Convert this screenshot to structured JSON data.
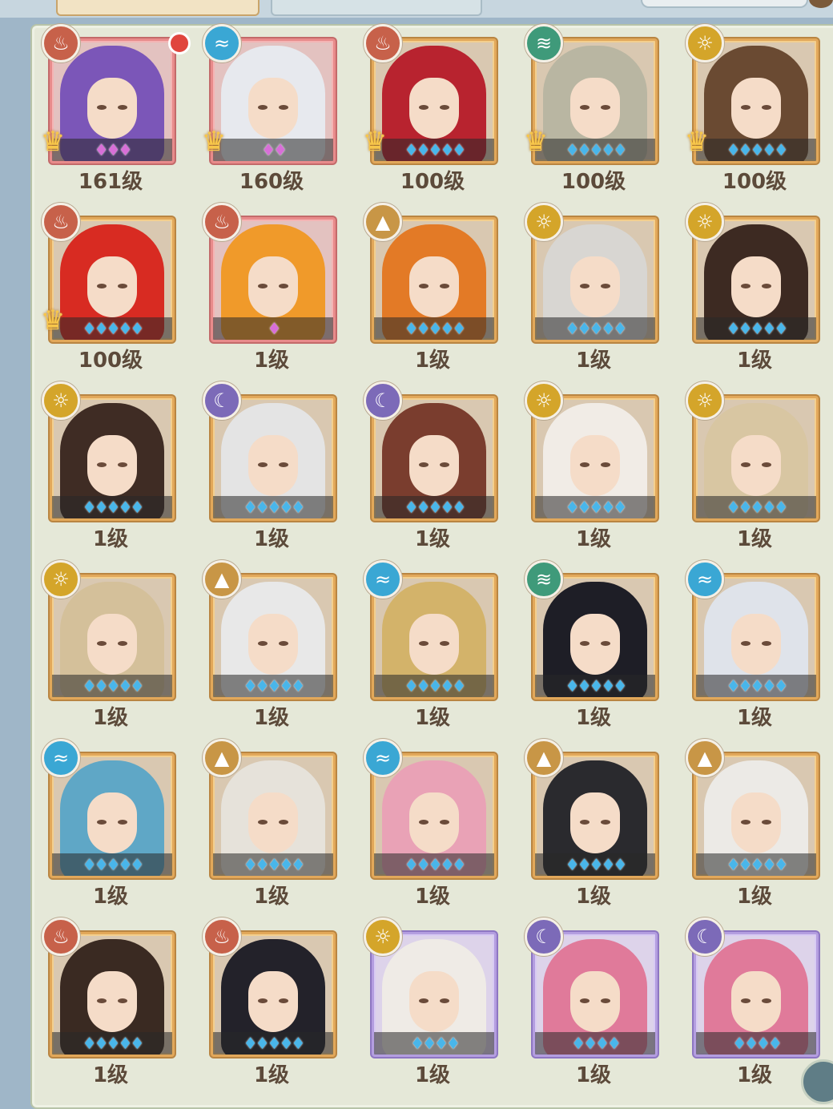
{
  "tabs": [
    {
      "label": "",
      "active": true
    },
    {
      "label": "",
      "active": false
    }
  ],
  "elements": {
    "fire": {
      "icon": "flame-icon",
      "glyph": "♨",
      "color": "#c7614a"
    },
    "water": {
      "icon": "wave-icon",
      "glyph": "≈",
      "color": "#3aa7d4"
    },
    "wind": {
      "icon": "tornado-icon",
      "glyph": "≋",
      "color": "#3f9a7a"
    },
    "light": {
      "icon": "sun-icon",
      "glyph": "☼",
      "color": "#d4a52a"
    },
    "earth": {
      "icon": "mountain-icon",
      "glyph": "▲",
      "color": "#c89646"
    },
    "void": {
      "icon": "crescent-icon",
      "glyph": "☾",
      "color": "#7c6ab8"
    }
  },
  "characters": [
    {
      "level": "161级",
      "element": "fire",
      "frame": "red",
      "stars": 3,
      "star_color": "pink",
      "awakened": true,
      "notification": true,
      "hair": "#7b56b8"
    },
    {
      "level": "160级",
      "element": "water",
      "frame": "red",
      "stars": 2,
      "star_color": "pink",
      "awakened": true,
      "notification": false,
      "hair": "#e7e9ee"
    },
    {
      "level": "100级",
      "element": "fire",
      "frame": "orange",
      "stars": 5,
      "star_color": "blue",
      "awakened": true,
      "notification": false,
      "hair": "#b8232f"
    },
    {
      "level": "100级",
      "element": "wind",
      "frame": "orange",
      "stars": 5,
      "star_color": "blue",
      "awakened": true,
      "notification": false,
      "hair": "#b9b6a2"
    },
    {
      "level": "100级",
      "element": "light",
      "frame": "orange",
      "stars": 5,
      "star_color": "blue",
      "awakened": true,
      "notification": false,
      "hair": "#6a4a32"
    },
    {
      "level": "100级",
      "element": "fire",
      "frame": "orange",
      "stars": 5,
      "star_color": "blue",
      "awakened": true,
      "notification": false,
      "hair": "#d82b22"
    },
    {
      "level": "1级",
      "element": "fire",
      "frame": "red",
      "stars": 1,
      "star_color": "pink",
      "awakened": false,
      "notification": false,
      "hair": "#f09a2a"
    },
    {
      "level": "1级",
      "element": "earth",
      "frame": "orange",
      "stars": 5,
      "star_color": "blue",
      "awakened": false,
      "notification": false,
      "hair": "#e37a26"
    },
    {
      "level": "1级",
      "element": "light",
      "frame": "orange",
      "stars": 5,
      "star_color": "blue",
      "awakened": false,
      "notification": false,
      "hair": "#d8d6d2"
    },
    {
      "level": "1级",
      "element": "light",
      "frame": "orange",
      "stars": 5,
      "star_color": "blue",
      "awakened": false,
      "notification": false,
      "hair": "#3d2a22"
    },
    {
      "level": "1级",
      "element": "light",
      "frame": "orange",
      "stars": 5,
      "star_color": "blue",
      "awakened": false,
      "notification": false,
      "hair": "#3f2c24"
    },
    {
      "level": "1级",
      "element": "void",
      "frame": "orange",
      "stars": 5,
      "star_color": "blue",
      "awakened": false,
      "notification": false,
      "hair": "#e4e4e4"
    },
    {
      "level": "1级",
      "element": "void",
      "frame": "orange",
      "stars": 5,
      "star_color": "blue",
      "awakened": false,
      "notification": false,
      "hair": "#7a3d2e"
    },
    {
      "level": "1级",
      "element": "light",
      "frame": "orange",
      "stars": 5,
      "star_color": "blue",
      "awakened": false,
      "notification": false,
      "hair": "#f1ece6"
    },
    {
      "level": "1级",
      "element": "light",
      "frame": "orange",
      "stars": 5,
      "star_color": "blue",
      "awakened": false,
      "notification": false,
      "hair": "#d8c6a2"
    },
    {
      "level": "1级",
      "element": "light",
      "frame": "orange",
      "stars": 5,
      "star_color": "blue",
      "awakened": false,
      "notification": false,
      "hair": "#d4c09a"
    },
    {
      "level": "1级",
      "element": "earth",
      "frame": "orange",
      "stars": 5,
      "star_color": "blue",
      "awakened": false,
      "notification": false,
      "hair": "#e8e8e8"
    },
    {
      "level": "1级",
      "element": "water",
      "frame": "orange",
      "stars": 5,
      "star_color": "blue",
      "awakened": false,
      "notification": false,
      "hair": "#d3b36a"
    },
    {
      "level": "1级",
      "element": "wind",
      "frame": "orange",
      "stars": 5,
      "star_color": "blue",
      "awakened": false,
      "notification": false,
      "hair": "#1e1e26"
    },
    {
      "level": "1级",
      "element": "water",
      "frame": "orange",
      "stars": 5,
      "star_color": "blue",
      "awakened": false,
      "notification": false,
      "hair": "#dfe3ea"
    },
    {
      "level": "1级",
      "element": "water",
      "frame": "orange",
      "stars": 5,
      "star_color": "blue",
      "awakened": false,
      "notification": false,
      "hair": "#5fa7c6"
    },
    {
      "level": "1级",
      "element": "earth",
      "frame": "orange",
      "stars": 5,
      "star_color": "blue",
      "awakened": false,
      "notification": false,
      "hair": "#e6e2da"
    },
    {
      "level": "1级",
      "element": "water",
      "frame": "orange",
      "stars": 5,
      "star_color": "blue",
      "awakened": false,
      "notification": false,
      "hair": "#e9a2b6"
    },
    {
      "level": "1级",
      "element": "earth",
      "frame": "orange",
      "stars": 5,
      "star_color": "blue",
      "awakened": false,
      "notification": false,
      "hair": "#2a2a2e"
    },
    {
      "level": "1级",
      "element": "earth",
      "frame": "orange",
      "stars": 5,
      "star_color": "blue",
      "awakened": false,
      "notification": false,
      "hair": "#eceae6"
    },
    {
      "level": "1级",
      "element": "fire",
      "frame": "orange",
      "stars": 5,
      "star_color": "blue",
      "awakened": false,
      "notification": false,
      "hair": "#3a2a22"
    },
    {
      "level": "1级",
      "element": "fire",
      "frame": "orange",
      "stars": 5,
      "star_color": "blue",
      "awakened": false,
      "notification": false,
      "hair": "#23222a"
    },
    {
      "level": "1级",
      "element": "light",
      "frame": "purple",
      "stars": 4,
      "star_color": "blue",
      "awakened": false,
      "notification": false,
      "hair": "#efebe6"
    },
    {
      "level": "1级",
      "element": "void",
      "frame": "purple",
      "stars": 4,
      "star_color": "blue",
      "awakened": false,
      "notification": false,
      "hair": "#e07a9a"
    },
    {
      "level": "1级",
      "element": "void",
      "frame": "purple",
      "stars": 4,
      "star_color": "blue",
      "awakened": false,
      "notification": false,
      "hair": "#e07a9a"
    }
  ]
}
